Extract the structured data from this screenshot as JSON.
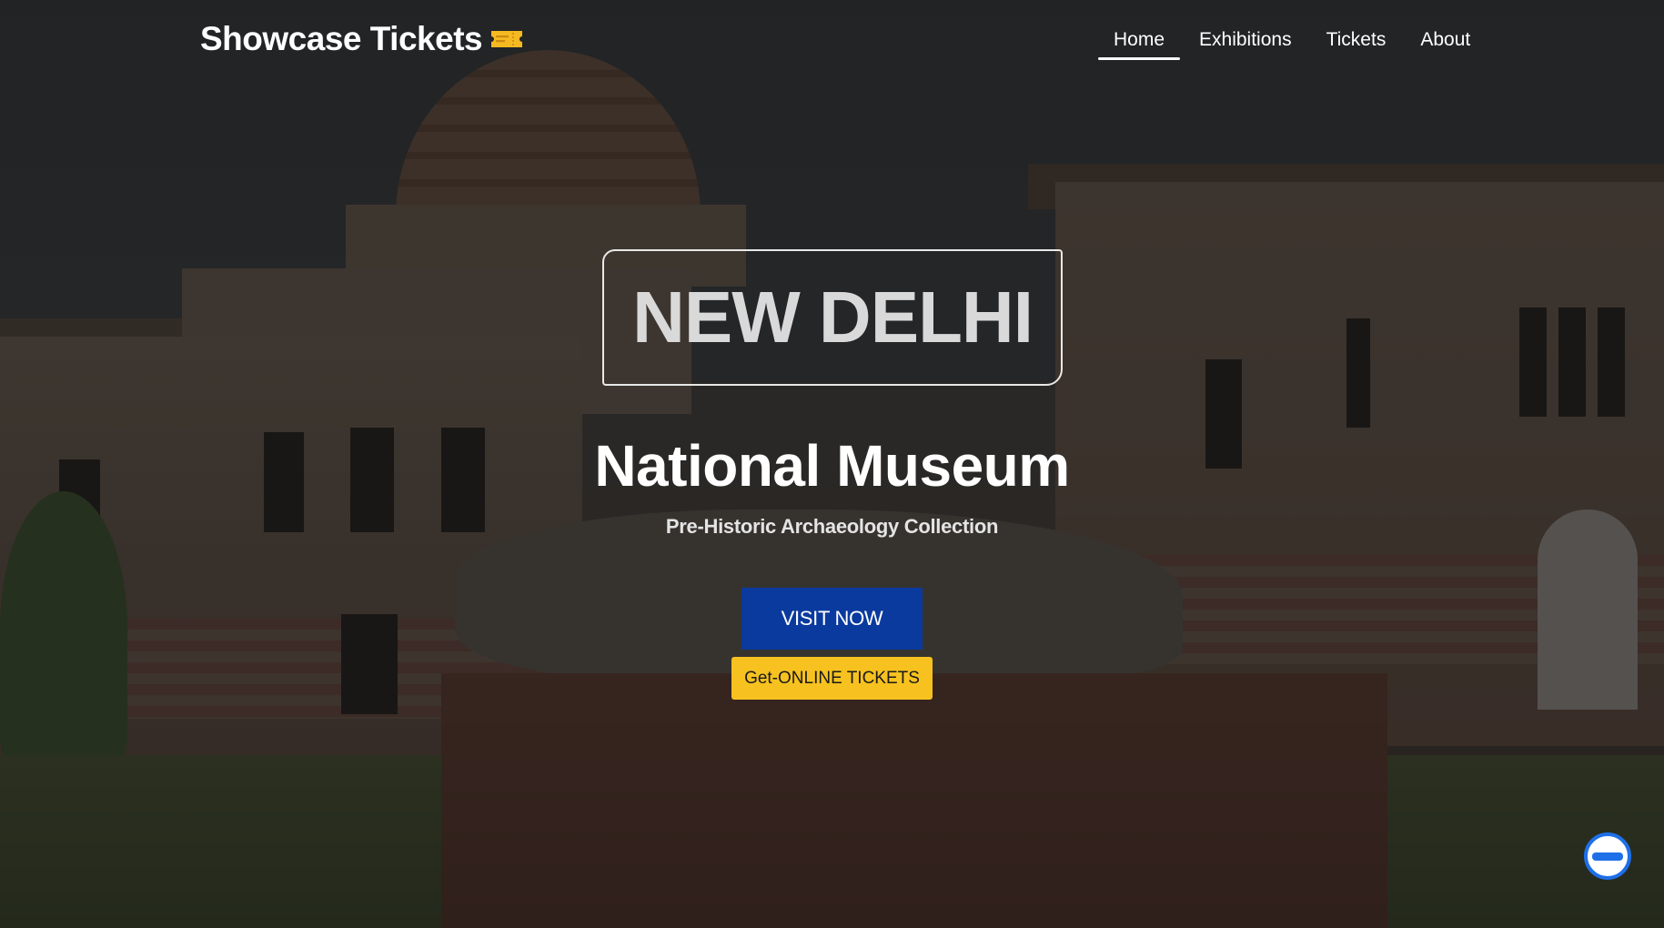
{
  "brand": {
    "name": "Showcase Tickets",
    "icon": "ticket-icon",
    "icon_color": "#f5b922"
  },
  "nav": {
    "items": [
      {
        "label": "Home",
        "active": true
      },
      {
        "label": "Exhibitions",
        "active": false
      },
      {
        "label": "Tickets",
        "active": false
      },
      {
        "label": "About",
        "active": false
      }
    ]
  },
  "hero": {
    "city": "NEW DELHI",
    "title": "National Museum",
    "subtitle": "Pre-Historic Archaeology Collection",
    "primary_cta": "VISIT NOW",
    "secondary_cta": "Get-ONLINE TICKETS",
    "background_image": "national-museum-building"
  },
  "chat": {
    "icon": "chat-icon",
    "color": "#1f6fe8"
  },
  "colors": {
    "primary_button": "#0a3a9e",
    "secondary_button": "#f7c220",
    "text": "#ffffff"
  }
}
